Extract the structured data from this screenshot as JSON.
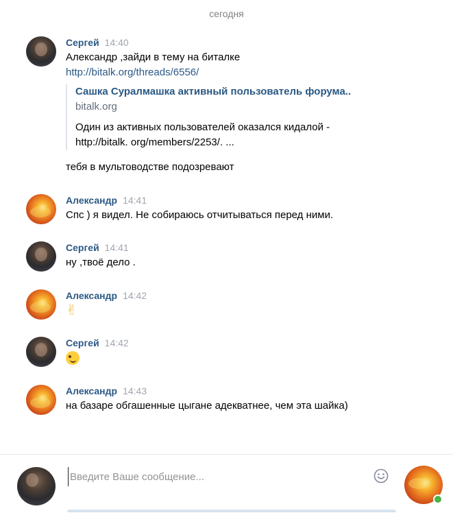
{
  "date_separator": "сегодня",
  "messages": [
    {
      "author": "Сергей",
      "time": "14:40",
      "text": "Александр ,зайди в тему на биталке",
      "link": "http://bitalk.org/threads/6556/",
      "preview": {
        "title": "Сашка Суралмашка активный пользователь форума..",
        "site": "bitalk.org",
        "desc_line1": "Один из активных пользователей оказался кидалой -",
        "desc_line2": "http://bitalk. org/members/2253/. ..."
      },
      "extra_text": "тебя в мультоводстве подозревают"
    },
    {
      "author": "Александр",
      "time": "14:41",
      "text": "Спс ) я видел. Не собираюсь отчитываться перед ними."
    },
    {
      "author": "Сергей",
      "time": "14:41",
      "text": "ну ,твоё дело ."
    },
    {
      "author": "Александр",
      "time": "14:42",
      "emoji": "✌"
    },
    {
      "author": "Сергей",
      "time": "14:42",
      "emoji_name": "wink-emoji-icon"
    },
    {
      "author": "Александр",
      "time": "14:43",
      "text": "на базаре обгашенные цыгане адекватнее, чем эта шайка)"
    }
  ],
  "composer": {
    "placeholder": "Введите Ваше сообщение..."
  },
  "colors": {
    "author": "#2a5885",
    "time": "#a0a6ad",
    "online": "#4bb34b"
  }
}
